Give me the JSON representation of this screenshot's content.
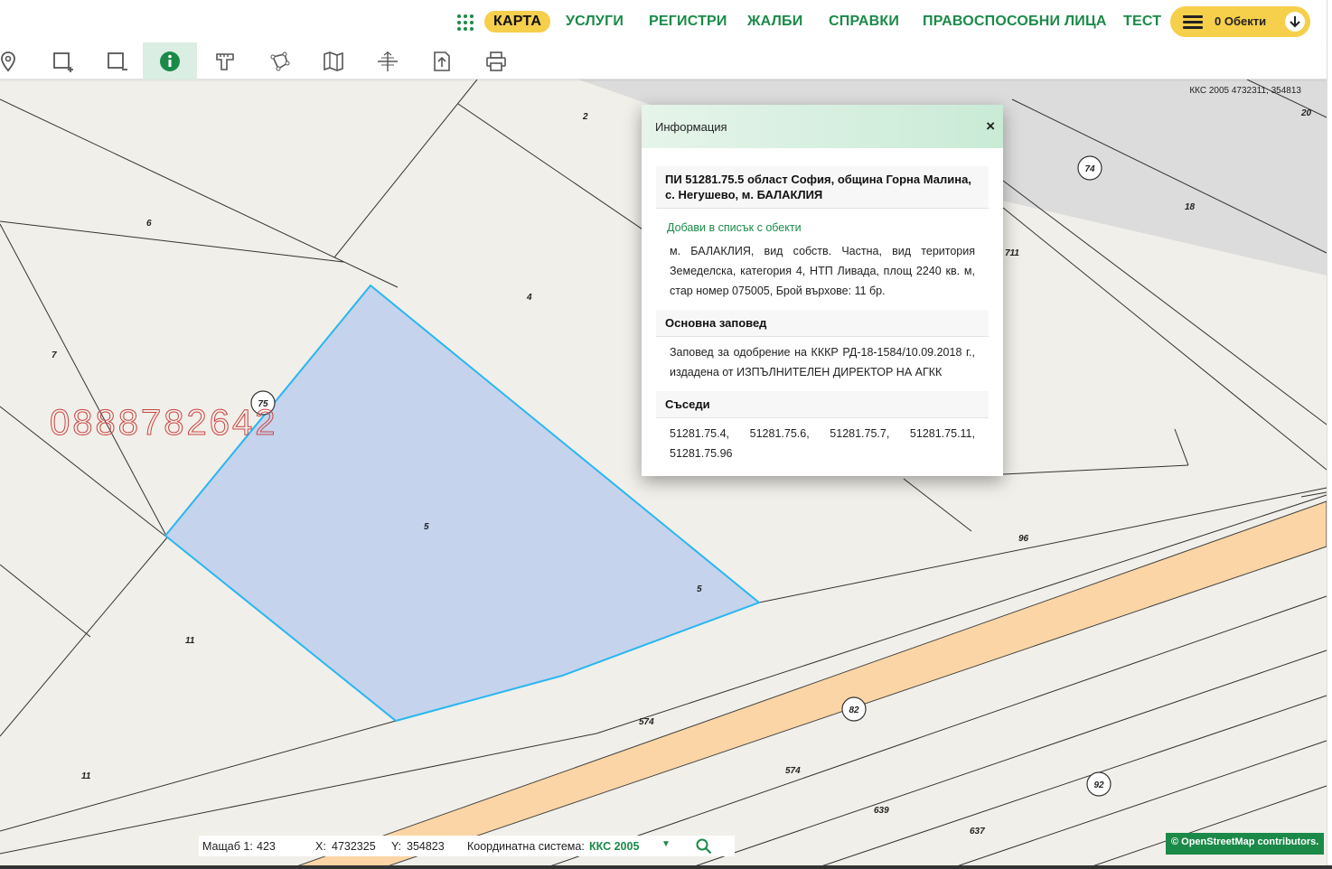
{
  "nav": {
    "items": [
      "КАРТА",
      "УСЛУГИ",
      "РЕГИСТРИ",
      "ЖАЛБИ",
      "СПРАВКИ",
      "ПРАВОСПОСОБНИ ЛИЦА",
      "ТЕСТ"
    ],
    "active_item": "КАРТА",
    "objects_label": "0 Обекти"
  },
  "toolbar": {
    "tools": [
      "marker-tool",
      "select-rectangle-add",
      "select-rectangle-remove",
      "info-tool",
      "measure-tool",
      "polygon-tool",
      "map-layers",
      "coordinates-tool",
      "export-tool",
      "print-tool"
    ],
    "active_tool": "info-tool"
  },
  "map": {
    "coord_readout": "ККС 2005 4732311, 354813",
    "watermark": "0888782642",
    "parcel_labels": [
      "2",
      "20",
      "74",
      "18",
      "711",
      "6",
      "4",
      "7",
      "75",
      "5",
      "5",
      "96",
      "11",
      "11",
      "82",
      "574",
      "574",
      "92",
      "639",
      "637"
    ],
    "road_labels": [
      "74",
      "75",
      "82",
      "92"
    ]
  },
  "popup": {
    "title": "Информация",
    "close_icon": "×",
    "parcel_heading": "ПИ 51281.75.5 област София, община Горна Малина, с. Негушево, м. БАЛАКЛИЯ",
    "add_link": "Добави в списък с обекти",
    "details": "м. БАЛАКЛИЯ, вид собств. Частна, вид територия Земеделска, категория 4, НТП Ливада, площ 2240 кв. м, стар номер 075005, Брой върхове: 11 бр.",
    "order_heading": "Основна заповед",
    "order_text": "Заповед за одобрение на КККР РД-18-1584/10.09.2018 г., издадена от ИЗПЪЛНИТЕЛЕН ДИРЕКТОР НА АГКК",
    "neighbors_heading": "Съседи",
    "neighbors_text": "51281.75.4, 51281.75.6, 51281.75.7, 51281.75.11, 51281.75.96"
  },
  "status": {
    "scale_label": "Мащаб 1:",
    "scale_value": "423",
    "x_label": "X:",
    "x_value": "4732325",
    "y_label": "Y:",
    "y_value": "354823",
    "crs_label": "Координатна система:",
    "crs_value": "ККС 2005"
  },
  "attribution": "© OpenStreetMap contributors.",
  "colors": {
    "brand_green": "#1b8a48",
    "accent_yellow": "#f6cf4b",
    "selected_parcel": "#c5d3ec",
    "selected_outline": "#29b6f0",
    "road": "#fbd5a5"
  }
}
